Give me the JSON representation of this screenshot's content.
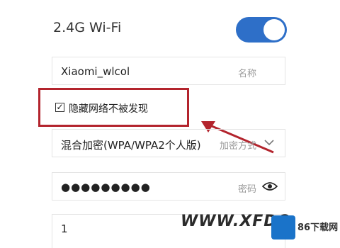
{
  "wifi": {
    "section_title": "2.4G Wi-Fi",
    "enabled": true
  },
  "fields": {
    "ssid_value": "Xiaomi_wlcol",
    "ssid_hint": "名称",
    "hide_network_label": "隐藏网络不被发现",
    "hide_network_checked": true,
    "encryption_value": "混合加密(WPA/WPA2个人版)",
    "encryption_hint": "加密方式",
    "password_value": "●●●●●●●●●",
    "password_hint": "密码",
    "channel_value": "1"
  },
  "watermark": {
    "text": "WWW.XFDO",
    "logo_text": "86下载网"
  },
  "colors": {
    "toggle_on": "#2e6fc8",
    "highlight": "#b3242d"
  }
}
